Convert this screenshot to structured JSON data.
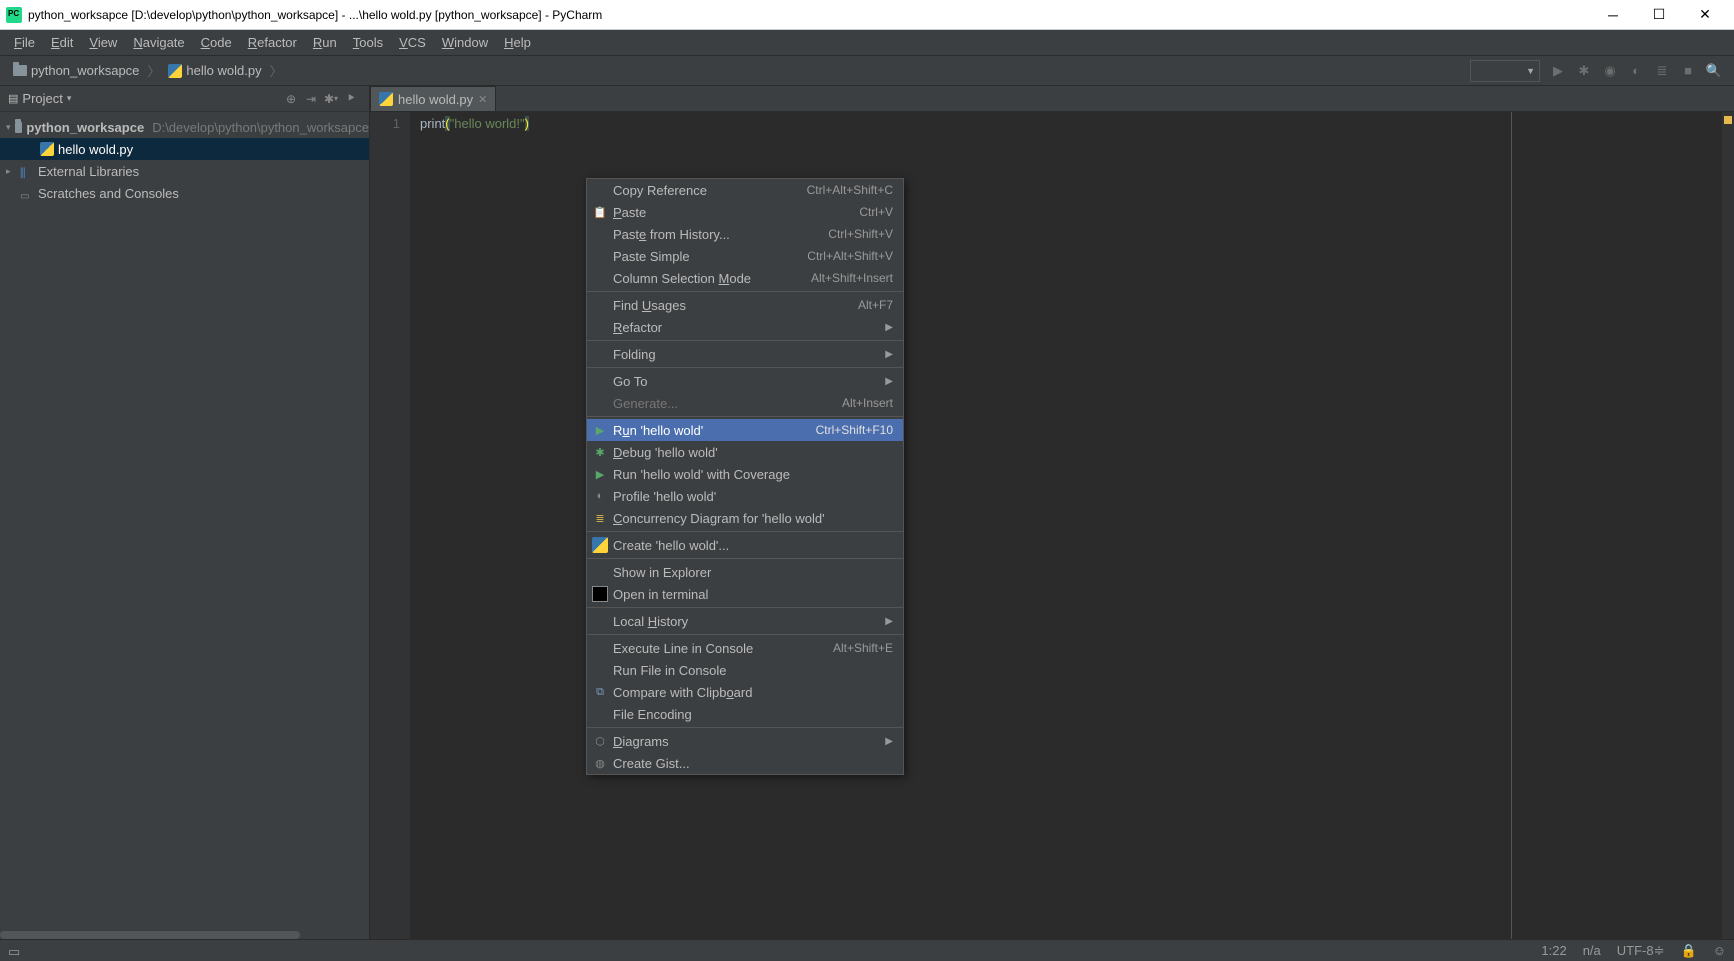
{
  "window": {
    "title": "python_worksapce [D:\\develop\\python\\python_worksapce] - ...\\hello wold.py [python_worksapce] - PyCharm"
  },
  "menubar": {
    "items": [
      "File",
      "Edit",
      "View",
      "Navigate",
      "Code",
      "Refactor",
      "Run",
      "Tools",
      "VCS",
      "Window",
      "Help"
    ]
  },
  "breadcrumb": {
    "project": "python_worksapce",
    "file": "hello wold.py"
  },
  "project_panel": {
    "title": "Project",
    "tree": {
      "root_name": "python_worksapce",
      "root_path": "D:\\develop\\python\\python_worksapce",
      "children": [
        {
          "name": "hello wold.py",
          "type": "py",
          "selected": true
        }
      ],
      "ext_libs": "External Libraries",
      "scratches": "Scratches and Consoles"
    }
  },
  "editor": {
    "tab_name": "hello wold.py",
    "line_numbers": [
      "1"
    ],
    "code": {
      "fn": "print",
      "open_paren": "(",
      "string": "\"hello world!\"",
      "close_paren": ")"
    }
  },
  "context_menu": {
    "items": [
      {
        "label": "Copy Reference",
        "shortcut": "Ctrl+Alt+Shift+C"
      },
      {
        "label": "Paste",
        "underline": 0,
        "shortcut": "Ctrl+V",
        "icon": "clip"
      },
      {
        "label": "Paste from History...",
        "underline": 4,
        "shortcut": "Ctrl+Shift+V"
      },
      {
        "label": "Paste Simple",
        "shortcut": "Ctrl+Alt+Shift+V"
      },
      {
        "label": "Column Selection Mode",
        "underline": 17,
        "shortcut": "Alt+Shift+Insert"
      },
      {
        "sep": true
      },
      {
        "label": "Find Usages",
        "underline": 5,
        "shortcut": "Alt+F7"
      },
      {
        "label": "Refactor",
        "underline": 0,
        "submenu": true
      },
      {
        "sep": true
      },
      {
        "label": "Folding",
        "submenu": true
      },
      {
        "sep": true
      },
      {
        "label": "Go To",
        "submenu": true
      },
      {
        "label": "Generate...",
        "shortcut": "Alt+Insert",
        "disabled": true
      },
      {
        "sep": true
      },
      {
        "label": "Run 'hello wold'",
        "underline": 1,
        "shortcut": "Ctrl+Shift+F10",
        "icon": "play",
        "highlight": true
      },
      {
        "label": "Debug 'hello wold'",
        "underline": 0,
        "icon": "bug"
      },
      {
        "label": "Run 'hello wold' with Coverage",
        "icon": "cov"
      },
      {
        "label": "Profile 'hello wold'",
        "icon": "profile"
      },
      {
        "label": "Concurrency Diagram for 'hello wold'",
        "underline": 0,
        "icon": "conc"
      },
      {
        "sep": true
      },
      {
        "label": "Create 'hello wold'...",
        "icon": "py"
      },
      {
        "sep": true
      },
      {
        "label": "Show in Explorer"
      },
      {
        "label": "Open in terminal",
        "icon": "term"
      },
      {
        "sep": true
      },
      {
        "label": "Local History",
        "underline": 6,
        "submenu": true
      },
      {
        "sep": true
      },
      {
        "label": "Execute Line in Console",
        "shortcut": "Alt+Shift+E"
      },
      {
        "label": "Run File in Console"
      },
      {
        "label": "Compare with Clipboard",
        "underline": 18,
        "icon": "compare"
      },
      {
        "label": "File Encoding"
      },
      {
        "sep": true
      },
      {
        "label": "Diagrams",
        "underline": 0,
        "submenu": true,
        "icon": "uml"
      },
      {
        "label": "Create Gist...",
        "icon": "gh"
      }
    ]
  },
  "statusbar": {
    "pos": "1:22",
    "sep": "n/a",
    "encoding": "UTF-8",
    "enc_arrow": "≑"
  }
}
